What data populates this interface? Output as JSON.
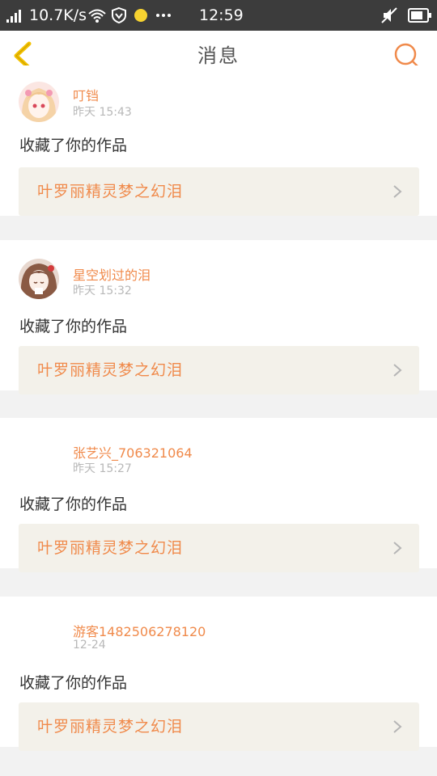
{
  "status_bar": {
    "speed": "10.7K/s",
    "time": "12:59"
  },
  "header": {
    "title": "消息"
  },
  "colors": {
    "accent": "#f08a4b",
    "back_arrow": "#f3c100",
    "card_link_bg": "#f3f1ea"
  },
  "notifications": [
    {
      "username": "叮铛",
      "time": "昨天 15:43",
      "action": "收藏了你的作品",
      "work_title": "叶罗丽精灵梦之幻泪",
      "avatar": "anime-girl-pink-avatar"
    },
    {
      "username": "星空划过的泪",
      "time": "昨天 15:32",
      "action": "收藏了你的作品",
      "work_title": "叶罗丽精灵梦之幻泪",
      "avatar": "anime-girl-brown-avatar"
    },
    {
      "username": "张艺兴_706321064",
      "time": "昨天 15:27",
      "action": "收藏了你的作品",
      "work_title": "叶罗丽精灵梦之幻泪",
      "avatar": "blank-avatar"
    },
    {
      "username": "游客1482506278120",
      "time": "12-24",
      "action": "收藏了你的作品",
      "work_title": "叶罗丽精灵梦之幻泪",
      "avatar": "blank-avatar"
    }
  ]
}
